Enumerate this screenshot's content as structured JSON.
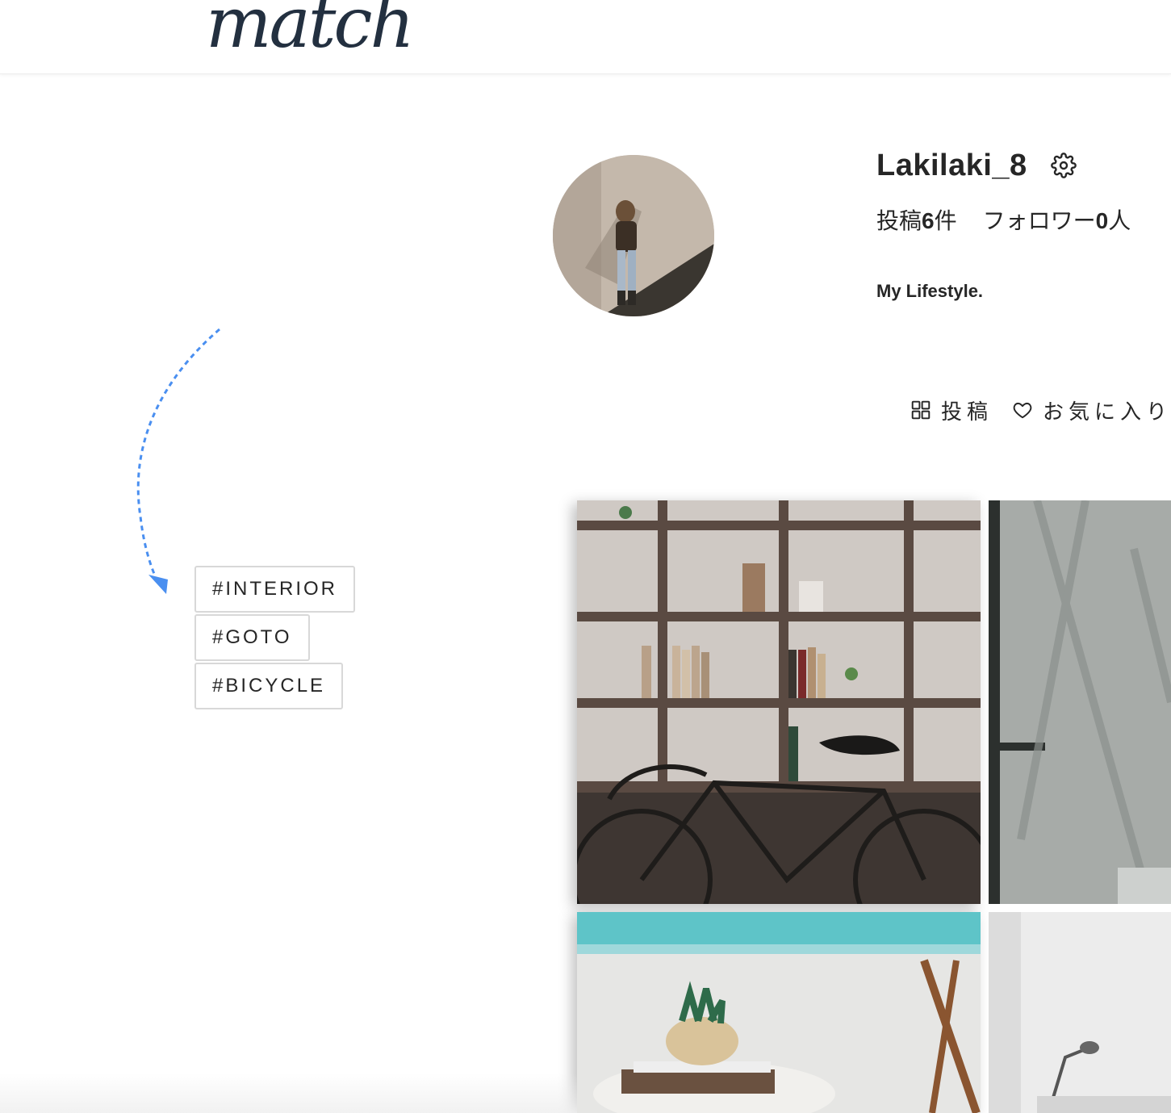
{
  "header": {
    "logo_text": "match"
  },
  "profile": {
    "username": "Lakilaki_8",
    "stats": {
      "posts_label": "投稿",
      "posts_count": "6",
      "posts_unit": "件",
      "followers_label": "フォロワー",
      "followers_count": "0",
      "followers_unit": "人"
    },
    "bio": "My Lifestyle."
  },
  "tabs": [
    {
      "label": "投稿",
      "icon": "grid-icon"
    },
    {
      "label": "お気に入り",
      "icon": "heart-icon"
    }
  ],
  "tags": [
    "#INTERIOR",
    "#GOTO",
    "#BICYCLE"
  ],
  "photos": [
    {
      "subject": "bicycle in front of wooden bookshelf"
    },
    {
      "subject": "window shadows on wall"
    },
    {
      "subject": "succulent plant on table by pool"
    },
    {
      "subject": "desk lamp in white room"
    }
  ],
  "colors": {
    "arrow": "#4a8ff0",
    "logo": "#233040",
    "tag_border": "#d8d8d8"
  }
}
